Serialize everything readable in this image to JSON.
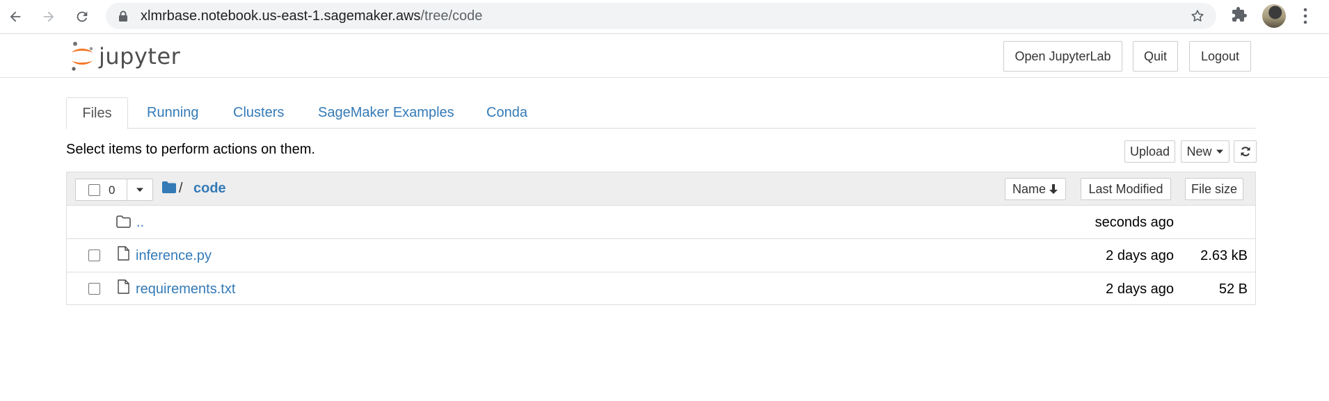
{
  "browser": {
    "url_host": "xlmrbase.notebook.us-east-1.sagemaker.aws",
    "url_path": "/tree/code"
  },
  "header": {
    "logo_text": "jupyter",
    "open_jupyterlab_label": "Open JupyterLab",
    "quit_label": "Quit",
    "logout_label": "Logout"
  },
  "tabs": [
    {
      "label": "Files",
      "active": true
    },
    {
      "label": "Running"
    },
    {
      "label": "Clusters"
    },
    {
      "label": "SageMaker Examples"
    },
    {
      "label": "Conda"
    }
  ],
  "toolbar": {
    "hint": "Select items to perform actions on them.",
    "upload_label": "Upload",
    "new_label": "New"
  },
  "list": {
    "selected_count": "0",
    "breadcrumb_sep": "/",
    "breadcrumb_current": "code",
    "columns": {
      "name": "Name",
      "last_modified": "Last Modified",
      "file_size": "File size"
    },
    "rows": [
      {
        "name": "..",
        "modified": "seconds ago",
        "size": "",
        "type": "folder"
      },
      {
        "name": "inference.py",
        "modified": "2 days ago",
        "size": "2.63 kB",
        "type": "file"
      },
      {
        "name": "requirements.txt",
        "modified": "2 days ago",
        "size": "52 B",
        "type": "file"
      }
    ]
  },
  "colors": {
    "link": "#337ab7",
    "jupyter_orange": "#f37726",
    "header_bg": "#eeeeee"
  }
}
